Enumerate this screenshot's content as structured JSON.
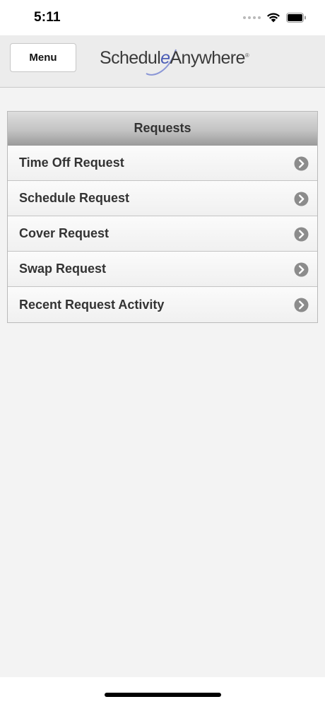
{
  "status_bar": {
    "time": "5:11",
    "icons": [
      "cellular-dots-icon",
      "wifi-icon",
      "battery-icon"
    ]
  },
  "header": {
    "menu_label": "Menu",
    "logo": {
      "part1": "Schedul",
      "part2": "e",
      "part3": "Anywhere",
      "registered": "®"
    }
  },
  "requests": {
    "title": "Requests",
    "items": [
      {
        "label": "Time Off Request",
        "icon": "chevron-right-icon"
      },
      {
        "label": "Schedule Request",
        "icon": "chevron-right-icon"
      },
      {
        "label": "Cover Request",
        "icon": "chevron-right-icon"
      },
      {
        "label": "Swap Request",
        "icon": "chevron-right-icon"
      },
      {
        "label": "Recent Request Activity",
        "icon": "chevron-right-icon"
      }
    ]
  },
  "colors": {
    "background": "#f3f3f3",
    "header_bg": "#ececec",
    "logo_accent": "#4a5bb5",
    "text": "#333333"
  }
}
